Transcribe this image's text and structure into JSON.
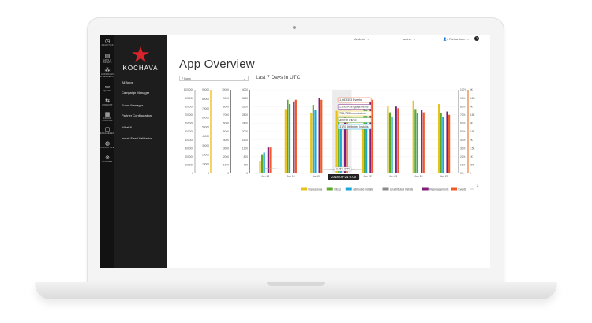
{
  "topbar": {
    "platform": "Android",
    "status": "active",
    "user": "J Richardson",
    "help": "?"
  },
  "iconbar": [
    {
      "icon": "analytics-icon",
      "glyph": "◷",
      "label": "ANALYTICS"
    },
    {
      "icon": "apps-assets-icon",
      "glyph": "▤",
      "label": "APPS & ASSETS"
    },
    {
      "icon": "audiences-icon",
      "glyph": "⁂",
      "label": "AUDIENCES & SEGMENTS"
    },
    {
      "icon": "query-icon",
      "glyph": "▭",
      "label": "QUERY"
    },
    {
      "icon": "pinpoint-icon",
      "glyph": "⇆",
      "label": "PINPOINT"
    },
    {
      "icon": "fraud-console-icon",
      "glyph": "▦",
      "label": "FRAUD CONSOLE"
    },
    {
      "icon": "engagement-icon",
      "glyph": "▢",
      "label": "ENGAGEMENT"
    },
    {
      "icon": "collective-icon",
      "glyph": "◍",
      "label": "COLLECTIVE"
    },
    {
      "icon": "planner-icon",
      "glyph": "⊘",
      "label": "PLANNER"
    }
  ],
  "brand": {
    "name": "KOCHAVA",
    "star_color": "#d8232a"
  },
  "nav": {
    "items": [
      "All Apps",
      "Campaign Manager",
      "Event Manager",
      "Partner Configuration",
      "What If",
      "Install Feed Validation"
    ]
  },
  "page": {
    "title": "App Overview",
    "range_value": "7 Days",
    "range_label": "Last 7 Days in UTC",
    "download_icon": "download-icon"
  },
  "chart_data": {
    "type": "bar",
    "categories": [
      "Jun 18",
      "Jun 19",
      "Jun 20",
      "Jun 21",
      "Jun 22",
      "Jun 23",
      "Jun 24",
      "Jun 25"
    ],
    "y_axes": [
      {
        "ticks": [
          "1000000",
          "900000",
          "800000",
          "700000",
          "600000",
          "500000",
          "400000",
          "300000",
          "200000",
          "100000",
          "0"
        ],
        "color": "#333333"
      },
      {
        "ticks": [
          "90000",
          "80000",
          "70000",
          "60000",
          "50000",
          "40000",
          "30000",
          "20000",
          "10000",
          "0"
        ],
        "color": "#f0b400"
      },
      {
        "ticks": [
          "10000",
          "9000",
          "8000",
          "7000",
          "6000",
          "5000",
          "4000",
          "3000",
          "2000",
          "1000",
          "0"
        ],
        "color": "#333333"
      },
      {
        "ticks": [
          "4000",
          "3600",
          "3200",
          "2800",
          "2400",
          "2000",
          "1600",
          "1200",
          "800",
          "400",
          "0"
        ],
        "color": "#7d1f7a"
      }
    ],
    "right_axes": [
      {
        "ticks": [
          "100%",
          "90%",
          "80%",
          "70%",
          "60%",
          "50%",
          "40%",
          "30%",
          "20%",
          "10%",
          "0%"
        ],
        "color": "#999999"
      },
      {
        "ticks": [
          "5K",
          "4.5K",
          "4K",
          "3.5K",
          "3K",
          "2.5K",
          "2K",
          "1.5K",
          "1K",
          "500",
          "0"
        ],
        "color": "#e97a2b"
      }
    ],
    "series": [
      {
        "name": "Impressions",
        "color": "#e8c21a",
        "values": [
          0.15,
          0.77,
          0.72,
          0.75,
          0.58,
          0.8,
          0.87,
          0.83
        ]
      },
      {
        "name": "Clicks",
        "color": "#5fa829",
        "values": [
          0.22,
          0.88,
          0.82,
          0.66,
          0.82,
          0.73,
          0.77,
          0.72
        ]
      },
      {
        "name": "Attributed Installs",
        "color": "#1aa6d9",
        "values": [
          0.25,
          0.83,
          0.76,
          0.58,
          0.76,
          0.68,
          0.72,
          0.67
        ]
      },
      {
        "name": "Unattributed Installs",
        "color": "#8a8a8a",
        "values": [
          0.0,
          0.0,
          0.0,
          0.0,
          0.0,
          0.0,
          0.0,
          0.0
        ]
      },
      {
        "name": "Reengagements",
        "color": "#7d1f7a",
        "values": [
          0.31,
          0.86,
          0.9,
          0.67,
          0.88,
          0.8,
          0.76,
          0.74
        ]
      },
      {
        "name": "Events",
        "color": "#f05a28",
        "values": [
          0.31,
          0.88,
          0.88,
          0.62,
          0.88,
          0.78,
          0.73,
          0.7
        ]
      }
    ],
    "cvr_line": {
      "name": "CVR",
      "color": "#aaaaaa",
      "values": [
        0.06,
        0.05,
        0.05,
        0.04,
        0.05,
        0.05,
        0.05,
        0.05
      ]
    },
    "highlight_index": 3,
    "tooltip": [
      {
        "text": "1,683,303 Events",
        "color": "#f05a28"
      },
      {
        "text": "2,692 Reengagements",
        "color": "#7d1f7a"
      },
      {
        "text": "756,785 Impressions",
        "color": "#e8c21a"
      },
      {
        "text": "40,036 Clicks",
        "color": "#5fa829"
      },
      {
        "text": "3170 Attributed Installs",
        "color": "#1aa6d9"
      }
    ],
    "cvr_tooltip": "0.96% CVR",
    "date_tooltip": "2018-06-21 0:00",
    "legend": [
      "Impressions",
      "Clicks",
      "Attributed Installs",
      "Unattributed Installs",
      "Reengagements",
      "Events",
      "CVR"
    ],
    "legend_placement": "bottom",
    "grid": true
  }
}
